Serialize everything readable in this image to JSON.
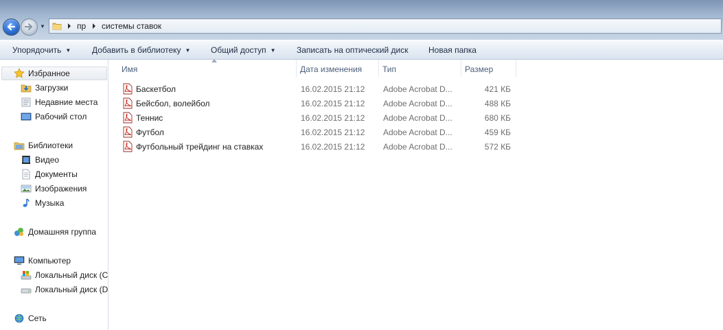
{
  "address": {
    "crumbs": [
      "пр",
      "системы ставок"
    ]
  },
  "toolbar": {
    "organize": "Упорядочить",
    "add_library": "Добавить в библиотеку",
    "share": "Общий доступ",
    "burn": "Записать на оптический диск",
    "new_folder": "Новая папка"
  },
  "nav": {
    "favorites": "Избранное",
    "downloads": "Загрузки",
    "recent": "Недавние места",
    "desktop": "Рабочий стол",
    "libraries": "Библиотеки",
    "video": "Видео",
    "documents": "Документы",
    "images": "Изображения",
    "music": "Музыка",
    "homegroup": "Домашняя группа",
    "computer": "Компьютер",
    "disk_c": "Локальный диск (C",
    "disk_d": "Локальный диск (D",
    "network": "Сеть"
  },
  "columns": {
    "name": "Имя",
    "date": "Дата изменения",
    "type": "Тип",
    "size": "Размер"
  },
  "files": [
    {
      "name": "Баскетбол",
      "date": "16.02.2015 21:12",
      "type": "Adobe Acrobat D...",
      "size": "421 КБ"
    },
    {
      "name": "Бейсбол, волейбол",
      "date": "16.02.2015 21:12",
      "type": "Adobe Acrobat D...",
      "size": "488 КБ"
    },
    {
      "name": "Теннис",
      "date": "16.02.2015 21:12",
      "type": "Adobe Acrobat D...",
      "size": "680 КБ"
    },
    {
      "name": "Футбол",
      "date": "16.02.2015 21:12",
      "type": "Adobe Acrobat D...",
      "size": "459 КБ"
    },
    {
      "name": "Футбольный трейдинг на ставках",
      "date": "16.02.2015 21:12",
      "type": "Adobe Acrobat D...",
      "size": "572 КБ"
    }
  ]
}
